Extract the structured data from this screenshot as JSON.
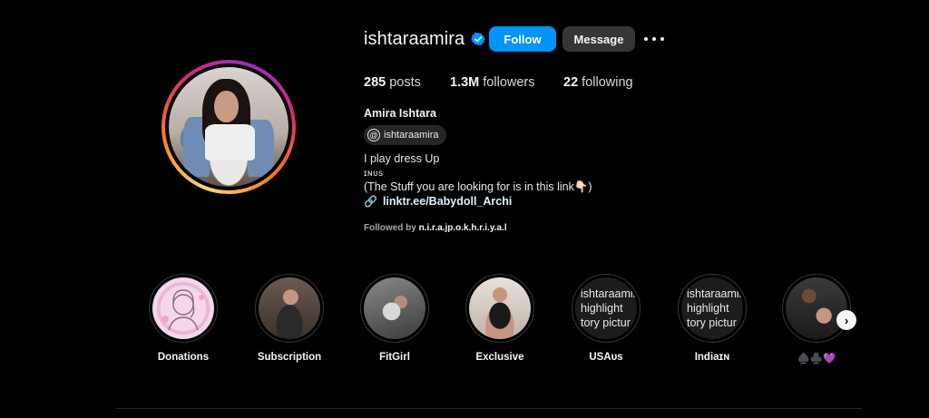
{
  "profile": {
    "username": "ishtaraamira",
    "verified": true,
    "follow_label": "Follow",
    "message_label": "Message",
    "stats": {
      "posts_count": "285",
      "posts_label": "posts",
      "followers_count": "1.3M",
      "followers_label": "followers",
      "following_count": "22",
      "following_label": "following"
    },
    "full_name": "Amira Ishtara",
    "threads_handle": "ishtaraamira",
    "bio_lines": [
      "I play dress Up",
      "ɪɴᴜs",
      "(The Stuff you are looking for is in this link👇🏻)"
    ],
    "link": "linktr.ee/Babydoll_Archi",
    "followed_by_prefix": "Followed by",
    "followed_by_name": "n.i.r.a.jp.o.k.h.r.i.y.a.l"
  },
  "highlights": [
    {
      "label": "Donations"
    },
    {
      "label": "Subscription"
    },
    {
      "label": "FitGirl"
    },
    {
      "label": "Exclusive"
    },
    {
      "label": "USAᴜs",
      "thumb_text": [
        "ishtaraamira",
        "highlight",
        "tory pictur"
      ]
    },
    {
      "label": "Indiaɪɴ",
      "thumb_text": [
        "ishtaraamira",
        "highlight",
        "tory pictur"
      ]
    },
    {
      "label": "♠️♣️💜"
    }
  ],
  "colors": {
    "background": "#000000",
    "follow_button": "#0095f6",
    "message_button": "#363636",
    "verified_badge": "#0095f6",
    "link": "#e0f1ff"
  },
  "icons": {
    "verified": "verified-badge-icon",
    "more": "more-options-icon",
    "threads": "threads-icon",
    "link": "link-icon",
    "next": "chevron-right-icon"
  }
}
